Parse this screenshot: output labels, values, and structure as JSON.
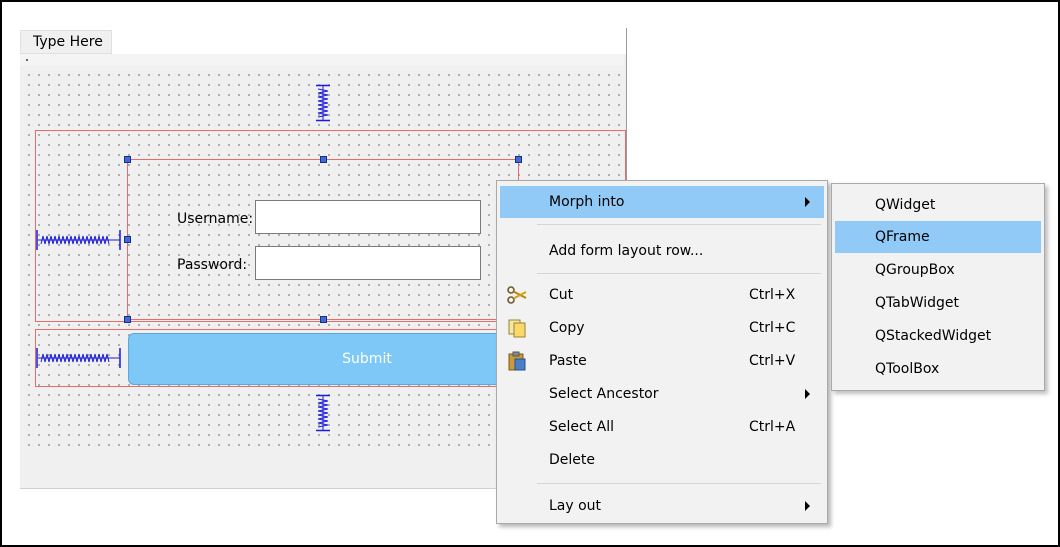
{
  "form": {
    "menubar_placeholder": "Type Here",
    "username_label": "Username:",
    "password_label": "Password:",
    "username_value": "",
    "password_value": "",
    "submit_label": "Submit"
  },
  "context_menu": {
    "items": [
      {
        "label": "Morph into",
        "shortcut": "",
        "submenu": true,
        "highlighted": true
      },
      {
        "label": "Add form layout row...",
        "shortcut": "",
        "submenu": false
      },
      {
        "label": "Cut",
        "shortcut": "Ctrl+X",
        "icon": "scissors-icon"
      },
      {
        "label": "Copy",
        "shortcut": "Ctrl+C",
        "icon": "copy-icon"
      },
      {
        "label": "Paste",
        "shortcut": "Ctrl+V",
        "icon": "paste-icon"
      },
      {
        "label": "Select Ancestor",
        "shortcut": "",
        "submenu": true
      },
      {
        "label": "Select All",
        "shortcut": "Ctrl+A"
      },
      {
        "label": "Delete",
        "shortcut": ""
      },
      {
        "label": "Lay out",
        "shortcut": "",
        "submenu": true
      }
    ]
  },
  "morph_submenu": {
    "items": [
      {
        "label": "QWidget"
      },
      {
        "label": "QFrame",
        "highlighted": true
      },
      {
        "label": "QGroupBox"
      },
      {
        "label": "QTabWidget"
      },
      {
        "label": "QStackedWidget"
      },
      {
        "label": "QToolBox"
      }
    ]
  },
  "colors": {
    "highlight": "#91c9f7",
    "layout_border": "#ea6b6b",
    "spacer": "#1b1bd8",
    "submit_bg": "#7ec8f7",
    "handle": "#3d6bd8"
  }
}
